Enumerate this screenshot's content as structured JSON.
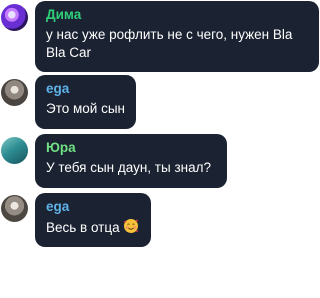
{
  "messages": [
    {
      "author": "Дима",
      "text": "у нас уже рофлить не с чего, нужен Bla Bla Car",
      "avatar_icon": "user-avatar-icon",
      "name_color": "#2fcf7a"
    },
    {
      "author": "ega",
      "text": "Это мой сын",
      "avatar_icon": "user-avatar-icon",
      "name_color": "#5fb2e8"
    },
    {
      "author": "Юра",
      "text": "У тебя сын даун, ты знал?",
      "avatar_icon": "user-avatar-icon",
      "name_color": "#6fe084"
    },
    {
      "author": "ega",
      "text": "Весь в отца",
      "emoji": "smiling-face-with-hearts-emoji",
      "avatar_icon": "user-avatar-icon",
      "name_color": "#5fb2e8"
    }
  ],
  "colors": {
    "bubble": "#1b2231",
    "text": "#ffffff",
    "background": "#ffffff"
  }
}
